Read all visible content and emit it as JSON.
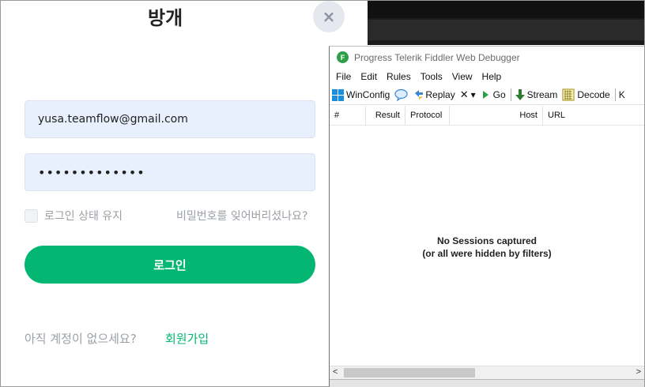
{
  "login": {
    "title": "방개",
    "close_icon": "×",
    "email_value": "yusa.teamflow@gmail.com",
    "password_value": "•••••••••••••",
    "remember_label": "로그인 상태 유지",
    "forgot_label": "비밀번호를 잊어버리셨나요?",
    "login_button": "로그인",
    "no_account_text": "아직 계정이 없으세요?",
    "signup_link": "회원가입",
    "accent_color": "#03b773"
  },
  "fiddler": {
    "logo": "F",
    "title": "Progress Telerik Fiddler Web Debugger",
    "menu": [
      "File",
      "Edit",
      "Rules",
      "Tools",
      "View",
      "Help"
    ],
    "toolbar": {
      "winconfig": "WinConfig",
      "replay": "Replay",
      "remove_arrow": "▾",
      "go": "Go",
      "stream": "Stream",
      "decode": "Decode",
      "cut": "K"
    },
    "columns": [
      "#",
      "Result",
      "Protocol",
      "Host",
      "URL"
    ],
    "empty_line1": "No Sessions captured",
    "empty_line2": "(or all were hidden by filters)",
    "scroll_left": "<",
    "scroll_right": ">"
  }
}
